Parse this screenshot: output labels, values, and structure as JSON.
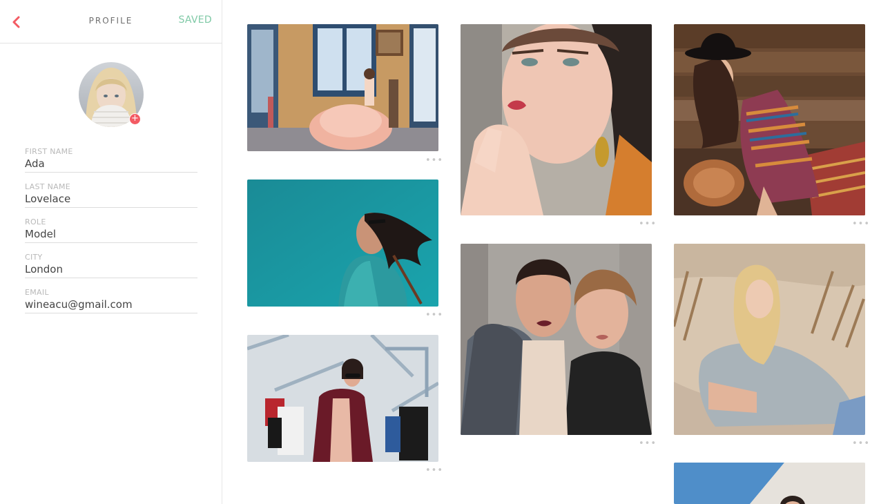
{
  "header": {
    "title": "PROFILE",
    "save_label": "SAVED"
  },
  "profile": {
    "fields": [
      {
        "label": "FIRST NAME",
        "value": "Ada"
      },
      {
        "label": "LAST NAME",
        "value": "Lovelace"
      },
      {
        "label": "ROLE",
        "value": "Model"
      },
      {
        "label": "CITY",
        "value": "London"
      },
      {
        "label": "EMAIL",
        "value": "wineacu@gmail.com"
      }
    ]
  },
  "gallery": {
    "more_label": "•••",
    "photos": [
      {
        "subject": "woman in pink ruffled gown by window"
      },
      {
        "subject": "woman in teal jacket against blue sky"
      },
      {
        "subject": "woman carrying shopping bags"
      },
      {
        "subject": "close-up portrait of woman with gold earring"
      },
      {
        "subject": "two women posing together"
      },
      {
        "subject": "woman in black hat and striped sweater"
      },
      {
        "subject": "blonde woman in grey sweater in dry grass"
      },
      {
        "subject": "woman portrait against blue sky"
      }
    ]
  },
  "colors": {
    "accent_back": "#f35b63",
    "saved_green": "#7fc9a6",
    "avatar_add": "#f35b63"
  }
}
